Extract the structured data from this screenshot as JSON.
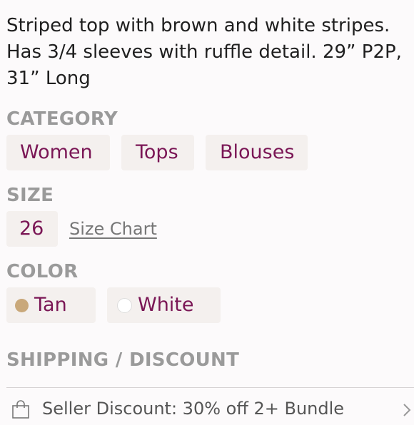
{
  "listing": {
    "description": "Striped top with brown and white stripes. Has 3/4 sleeves with ruffle detail. 29” P2P, 31” Long"
  },
  "category": {
    "heading": "CATEGORY",
    "chips": [
      "Women",
      "Tops",
      "Blouses"
    ]
  },
  "size": {
    "heading": "SIZE",
    "value": "26",
    "chart_link": "Size Chart"
  },
  "color": {
    "heading": "COLOR",
    "options": [
      {
        "label": "Tan",
        "swatch": "#c9a87a"
      },
      {
        "label": "White",
        "swatch": "#ffffff"
      }
    ]
  },
  "shipping": {
    "heading": "SHIPPING / DISCOUNT",
    "seller_discount": "Seller Discount: 30% off 2+ Bundle",
    "icon": "shopping-bag-icon"
  },
  "colors": {
    "accent": "#7a1655",
    "chip_bg": "#f4f0ee",
    "heading": "#9a9a9a"
  }
}
